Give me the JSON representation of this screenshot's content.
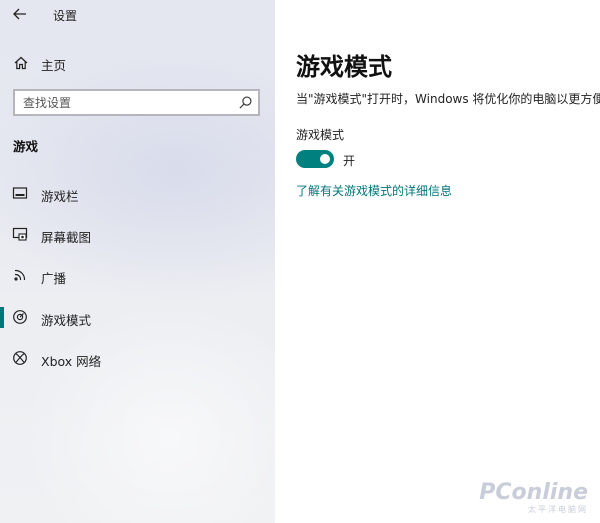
{
  "app": {
    "title": "设置"
  },
  "sidebar": {
    "home_label": "主页",
    "search": {
      "placeholder": "查找设置",
      "value": ""
    },
    "section_title": "游戏",
    "items": [
      {
        "label": "游戏栏",
        "icon": "game-bar-icon"
      },
      {
        "label": "屏幕截图",
        "icon": "screen-capture-icon"
      },
      {
        "label": "广播",
        "icon": "broadcast-icon"
      },
      {
        "label": "游戏模式",
        "icon": "game-mode-icon",
        "active": true
      },
      {
        "label": "Xbox 网络",
        "icon": "xbox-icon"
      }
    ]
  },
  "main": {
    "title": "游戏模式",
    "description": "当\"游戏模式\"打开时，Windows 将优化你的电脑以更方便",
    "setting": {
      "label": "游戏模式",
      "toggle_on": true,
      "state_label": "开"
    },
    "link_text": "了解有关游戏模式的详细信息"
  },
  "watermark": {
    "logo": "PConline",
    "subtitle": "太平洋电脑网"
  },
  "colors": {
    "accent": "#00817f",
    "link": "#00767a",
    "active_indicator": "#00777a"
  }
}
